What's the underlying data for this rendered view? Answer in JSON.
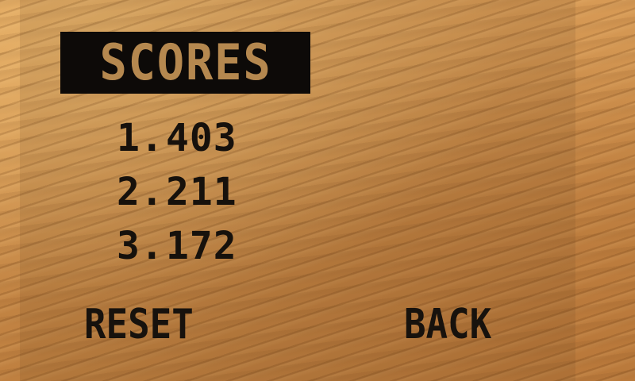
{
  "screen": {
    "title": "SCORES"
  },
  "scores": [
    {
      "rank": "1.",
      "value": "403"
    },
    {
      "rank": "2.",
      "value": "211"
    },
    {
      "rank": "3.",
      "value": "172"
    }
  ],
  "buttons": {
    "reset_label": "RESET",
    "back_label": "BACK"
  },
  "colors": {
    "sand": "#c98f4e",
    "title_bg": "#0d0a08",
    "title_text": "#b5884f",
    "text": "#16110c"
  }
}
